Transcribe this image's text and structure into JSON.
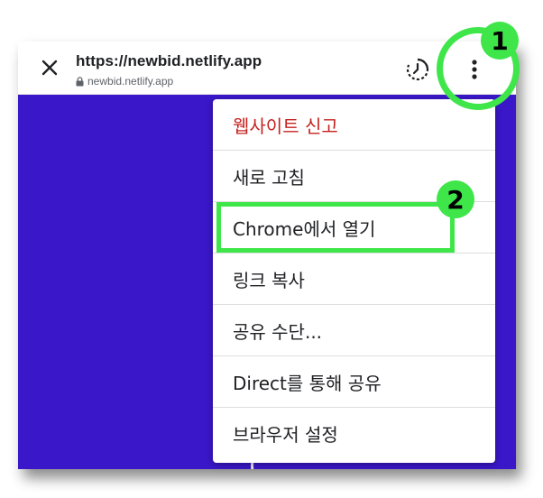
{
  "toolbar": {
    "url": "https://newbid.netlify.app",
    "domain": "newbid.netlify.app",
    "close_icon": "close-icon",
    "lock_icon": "lock-icon",
    "history_icon": "history-icon",
    "more_icon": "more-vert-icon"
  },
  "menu": {
    "items": [
      {
        "label": "웹사이트 신고"
      },
      {
        "label": "새로 고침"
      },
      {
        "label": "Chrome에서 열기"
      },
      {
        "label": "링크 복사"
      },
      {
        "label": "공유 수단..."
      },
      {
        "label": "Direct를 통해 공유"
      },
      {
        "label": "브라우저 설정"
      }
    ]
  },
  "annotations": {
    "step1": "1",
    "step2": "2",
    "color": "#3ee64a"
  },
  "colors": {
    "page_background": "#3a17c9",
    "danger_text": "#c5221f"
  }
}
